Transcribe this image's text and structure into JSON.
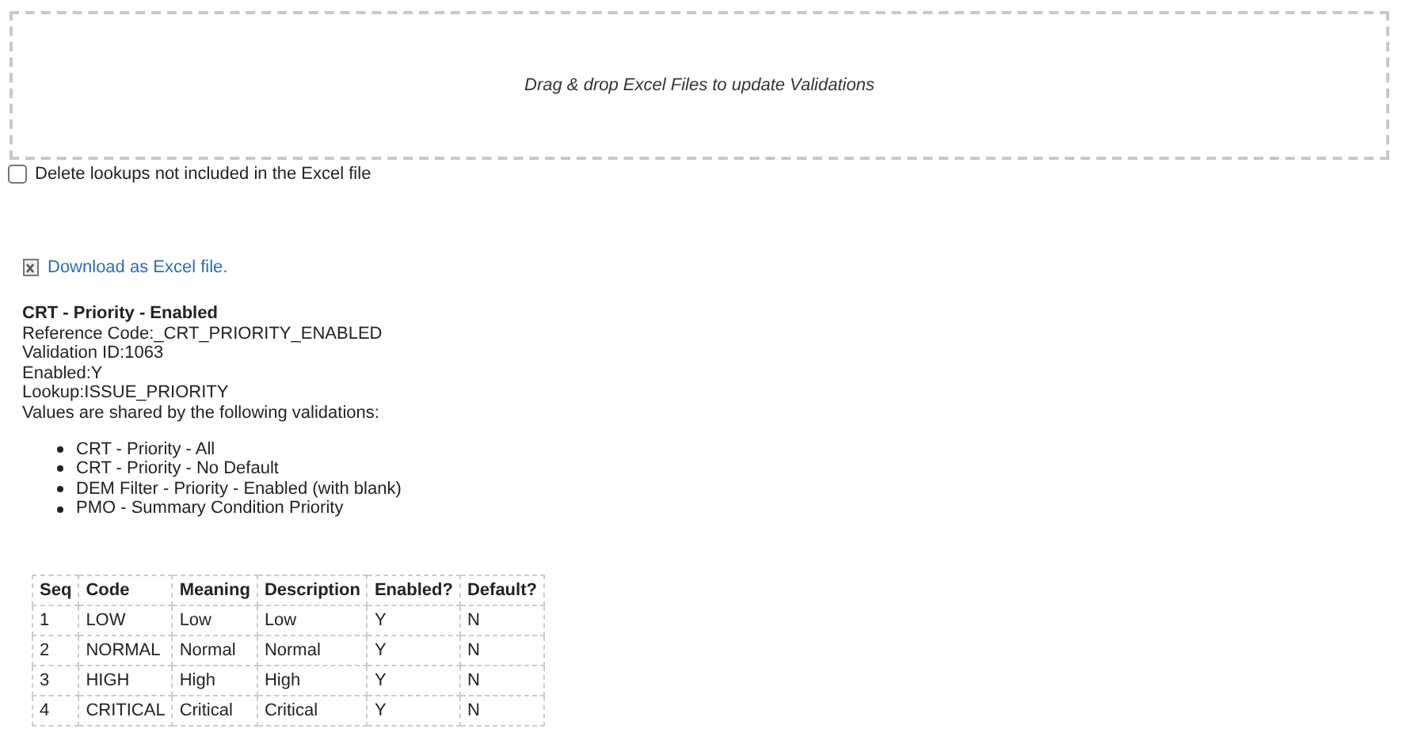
{
  "dropzone": {
    "text": "Drag & drop Excel Files to update Validations"
  },
  "delete_option": {
    "label": "Delete lookups not included in the Excel file",
    "checked": false
  },
  "download_link": "Download as Excel file.",
  "validation": {
    "title": "CRT - Priority - Enabled",
    "details": [
      "Reference Code:_CRT_PRIORITY_ENABLED",
      "Validation ID:1063",
      "Enabled:Y",
      "Lookup:ISSUE_PRIORITY",
      "Values are shared by the following validations:"
    ],
    "shared_validations": [
      "CRT - Priority - All",
      "CRT - Priority - No Default",
      "DEM Filter - Priority - Enabled (with blank)",
      "PMO - Summary Condition Priority"
    ]
  },
  "table": {
    "columns": [
      "Seq",
      "Code",
      "Meaning",
      "Description",
      "Enabled?",
      "Default?"
    ],
    "rows": [
      [
        "1",
        "LOW",
        "Low",
        "Low",
        "Y",
        "N"
      ],
      [
        "2",
        "NORMAL",
        "Normal",
        "Normal",
        "Y",
        "N"
      ],
      [
        "3",
        "HIGH",
        "High",
        "High",
        "Y",
        "N"
      ],
      [
        "4",
        "CRITICAL",
        "Critical",
        "Critical",
        "Y",
        "N"
      ]
    ]
  }
}
